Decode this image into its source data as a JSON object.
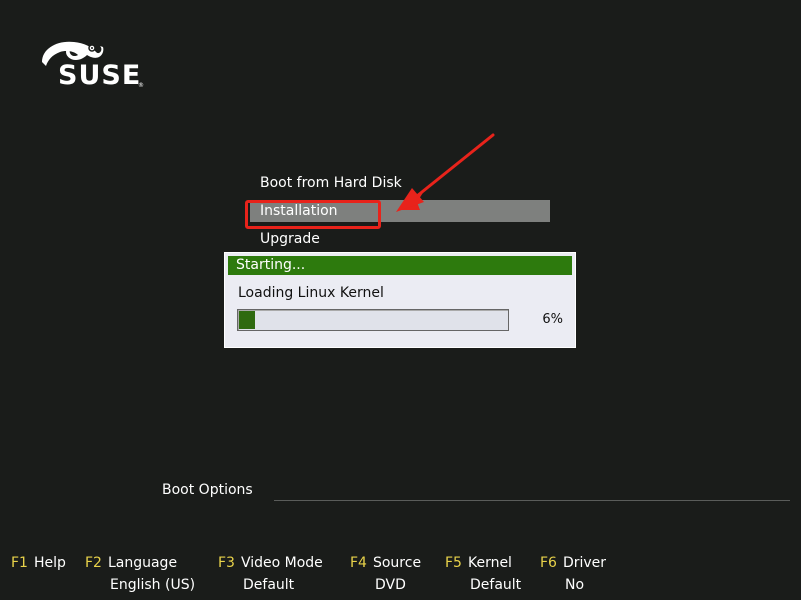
{
  "logo": {
    "text": "SUSE",
    "reg": "®"
  },
  "menu": {
    "items": [
      {
        "label": "Boot from Hard Disk"
      },
      {
        "label": "Installation"
      },
      {
        "label": "Upgrade"
      }
    ],
    "selected_index": 1
  },
  "dialog": {
    "title": "Starting...",
    "message": "Loading Linux Kernel",
    "progress_percent": 6,
    "progress_text": "6%"
  },
  "boot_options": {
    "label": "Boot Options",
    "value": ""
  },
  "function_keys": [
    {
      "key": "F1",
      "name": "Help",
      "value": ""
    },
    {
      "key": "F2",
      "name": "Language",
      "value": "English (US)"
    },
    {
      "key": "F3",
      "name": "Video Mode",
      "value": "Default"
    },
    {
      "key": "F4",
      "name": "Source",
      "value": "DVD"
    },
    {
      "key": "F5",
      "name": "Kernel",
      "value": "Default"
    },
    {
      "key": "F6",
      "name": "Driver",
      "value": "No"
    }
  ],
  "colors": {
    "background": "#1a1c1a",
    "selected_bg": "#7e807e",
    "dialog_title_bg": "#2d7a0d",
    "progress_fill": "#2f6a10",
    "fkey_key": "#e8d24a",
    "annotation_red": "#e8231b"
  }
}
